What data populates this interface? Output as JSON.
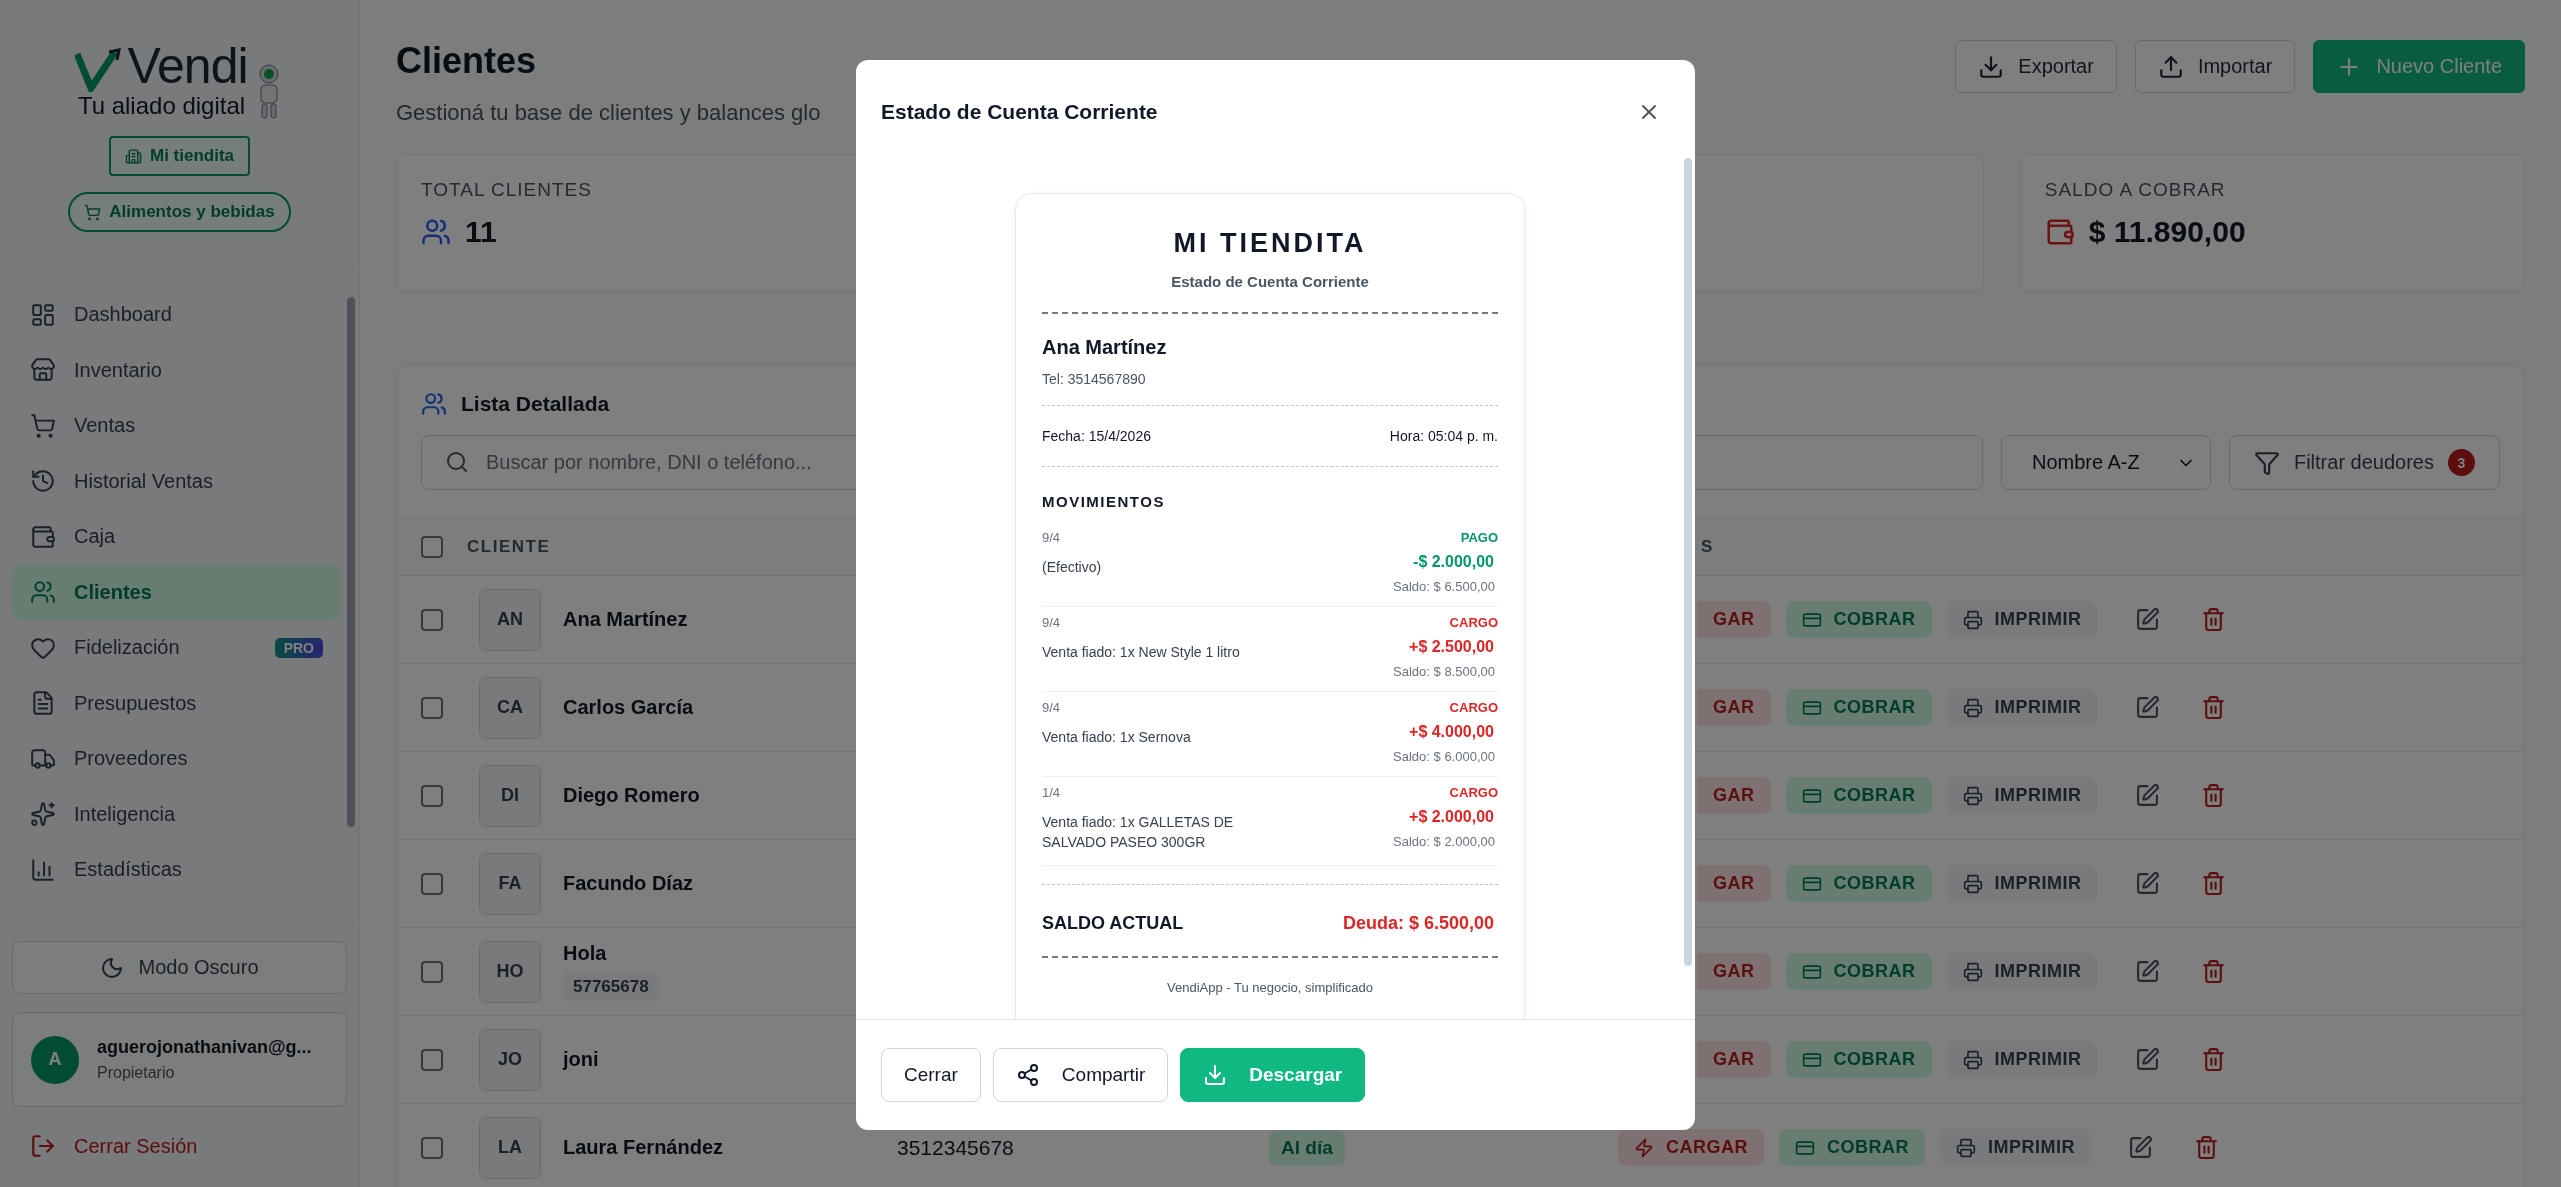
{
  "sidebar": {
    "logo_text": "Vendi",
    "tagline": "Tu aliado digital",
    "store_chip": "Mi tiendita",
    "category_chip": "Alimentos y bebidas",
    "nav": [
      {
        "label": "Dashboard",
        "selected": false
      },
      {
        "label": "Inventario",
        "selected": false
      },
      {
        "label": "Ventas",
        "selected": false
      },
      {
        "label": "Historial Ventas",
        "selected": false
      },
      {
        "label": "Caja",
        "selected": false
      },
      {
        "label": "Clientes",
        "selected": true
      },
      {
        "label": "Fidelización",
        "selected": false,
        "badge": "PRO"
      },
      {
        "label": "Presupuestos",
        "selected": false
      },
      {
        "label": "Proveedores",
        "selected": false
      },
      {
        "label": "Inteligencia",
        "selected": false
      },
      {
        "label": "Estadísticas",
        "selected": false
      }
    ],
    "dark_mode_button": "Modo Oscuro",
    "user": {
      "initial": "A",
      "email": "aguerojonathanivan@g...",
      "role": "Propietario"
    },
    "logout": "Cerrar Sesión"
  },
  "header": {
    "title": "Clientes",
    "subtitle": "Gestioná tu base de clientes y balances glo",
    "buttons": [
      {
        "label": "Exportar",
        "kind": "export"
      },
      {
        "label": "Importar",
        "kind": "import"
      },
      {
        "label": "Nuevo Cliente",
        "kind": "primary"
      }
    ]
  },
  "stats": [
    {
      "kind": "clients",
      "label": "TOTAL CLIENTES",
      "value": "11"
    },
    {
      "kind": "covered"
    },
    {
      "kind": "balance",
      "label": "SALDO A COBRAR",
      "value": "$ 11.890,00"
    }
  ],
  "list": {
    "title": "Lista Detallada",
    "search": {
      "placeholder": "Buscar por nombre, DNI o teléfono..."
    },
    "sort": {
      "value": "Nombre A-Z"
    },
    "filter": {
      "label": "Filtrar deudores",
      "count": "3"
    },
    "columns": [
      "CLIENTE",
      "S"
    ],
    "all_checked": false,
    "rows": [
      {
        "initials": "AN",
        "name": "Ana Martínez",
        "checked": false,
        "charge": "GAR",
        "charge_cut": true,
        "collect": "COBRAR",
        "print": "IMPRIMIR"
      },
      {
        "initials": "CA",
        "name": "Carlos García",
        "checked": false,
        "charge": "GAR",
        "charge_cut": true,
        "collect": "COBRAR",
        "print": "IMPRIMIR"
      },
      {
        "initials": "DI",
        "name": "Diego Romero",
        "checked": false,
        "charge": "GAR",
        "charge_cut": true,
        "collect": "COBRAR",
        "print": "IMPRIMIR"
      },
      {
        "initials": "FA",
        "name": "Facundo Díaz",
        "checked": false,
        "charge": "GAR",
        "charge_cut": true,
        "collect": "COBRAR",
        "print": "IMPRIMIR"
      },
      {
        "initials": "HO",
        "name": "Hola",
        "tag": "57765678",
        "checked": false,
        "charge": "GAR",
        "charge_cut": true,
        "collect": "COBRAR",
        "print": "IMPRIMIR"
      },
      {
        "initials": "JO",
        "name": "joni",
        "checked": false,
        "charge": "GAR",
        "charge_cut": true,
        "collect": "COBRAR",
        "print": "IMPRIMIR"
      },
      {
        "initials": "LA",
        "name": "Laura Fernández",
        "checked": false,
        "phone": "3512345678",
        "status": "Al día",
        "charge": "CARGAR",
        "charge_cut": false,
        "collect": "COBRAR",
        "print": "IMPRIMIR"
      }
    ]
  },
  "modal": {
    "title": "Estado de Cuenta Corriente",
    "receipt": {
      "store": "MI TIENDITA",
      "subtitle": "Estado de Cuenta Corriente",
      "client": "Ana Martínez",
      "phone": "Tel: 3514567890",
      "date": "Fecha: 15/4/2026",
      "time": "Hora: 05:04 p. m.",
      "section": "MOVIMIENTOS",
      "movements": [
        {
          "kind": "payment",
          "date": "9/4",
          "description": "(Efectivo)",
          "type": "PAGO",
          "amount": "-$ 2.000,00",
          "balance": "Saldo: $ 6.500,00"
        },
        {
          "kind": "charge",
          "date": "9/4",
          "description": "Venta fiado: 1x New Style 1 litro",
          "type": "CARGO",
          "amount": "+$ 2.500,00",
          "balance": "Saldo: $ 8.500,00"
        },
        {
          "kind": "charge",
          "date": "9/4",
          "description": "Venta fiado: 1x Sernova",
          "type": "CARGO",
          "amount": "+$ 4.000,00",
          "balance": "Saldo: $ 6.000,00"
        },
        {
          "kind": "charge",
          "date": "1/4",
          "description": "Venta fiado: 1x GALLETAS DE SALVADO PASEO 300GR",
          "type": "CARGO",
          "amount": "+$ 2.000,00",
          "balance": "Saldo: $ 2.000,00"
        }
      ],
      "total_label": "SALDO ACTUAL",
      "total": "Deuda: $ 6.500,00",
      "footer": "VendiApp - Tu negocio, simplificado"
    },
    "buttons": [
      {
        "label": "Cerrar",
        "kind": "close"
      },
      {
        "label": "Compartir",
        "kind": "share"
      },
      {
        "label": "Descargar",
        "kind": "download"
      }
    ]
  }
}
